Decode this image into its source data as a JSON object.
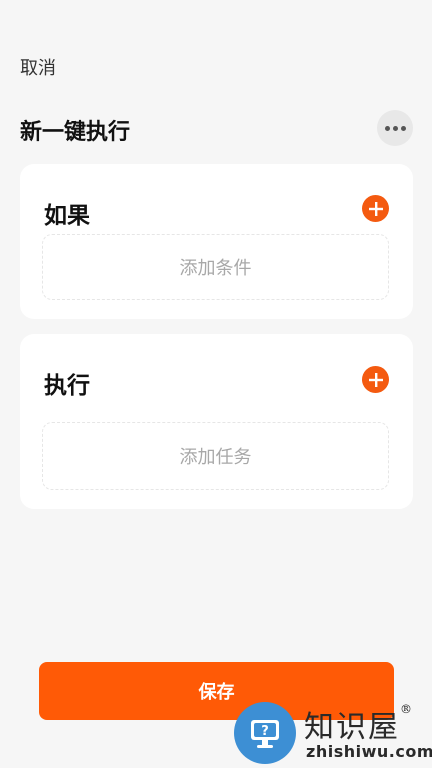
{
  "header": {
    "cancel_label": "取消",
    "title": "新一键执行",
    "more_icon": "more-horizontal-icon"
  },
  "if_card": {
    "title": "如果",
    "add_icon": "plus-icon",
    "placeholder": "添加条件"
  },
  "do_card": {
    "title": "执行",
    "add_icon": "plus-icon",
    "placeholder": "添加任务"
  },
  "footer": {
    "save_label": "保存"
  },
  "watermark": {
    "name": "知识屋",
    "registered": "®",
    "url": "zhishiwu.com"
  },
  "colors": {
    "accent": "#ff5a06",
    "background": "#f6f6f6",
    "card": "#ffffff",
    "placeholder_text": "#a8a8a8"
  }
}
